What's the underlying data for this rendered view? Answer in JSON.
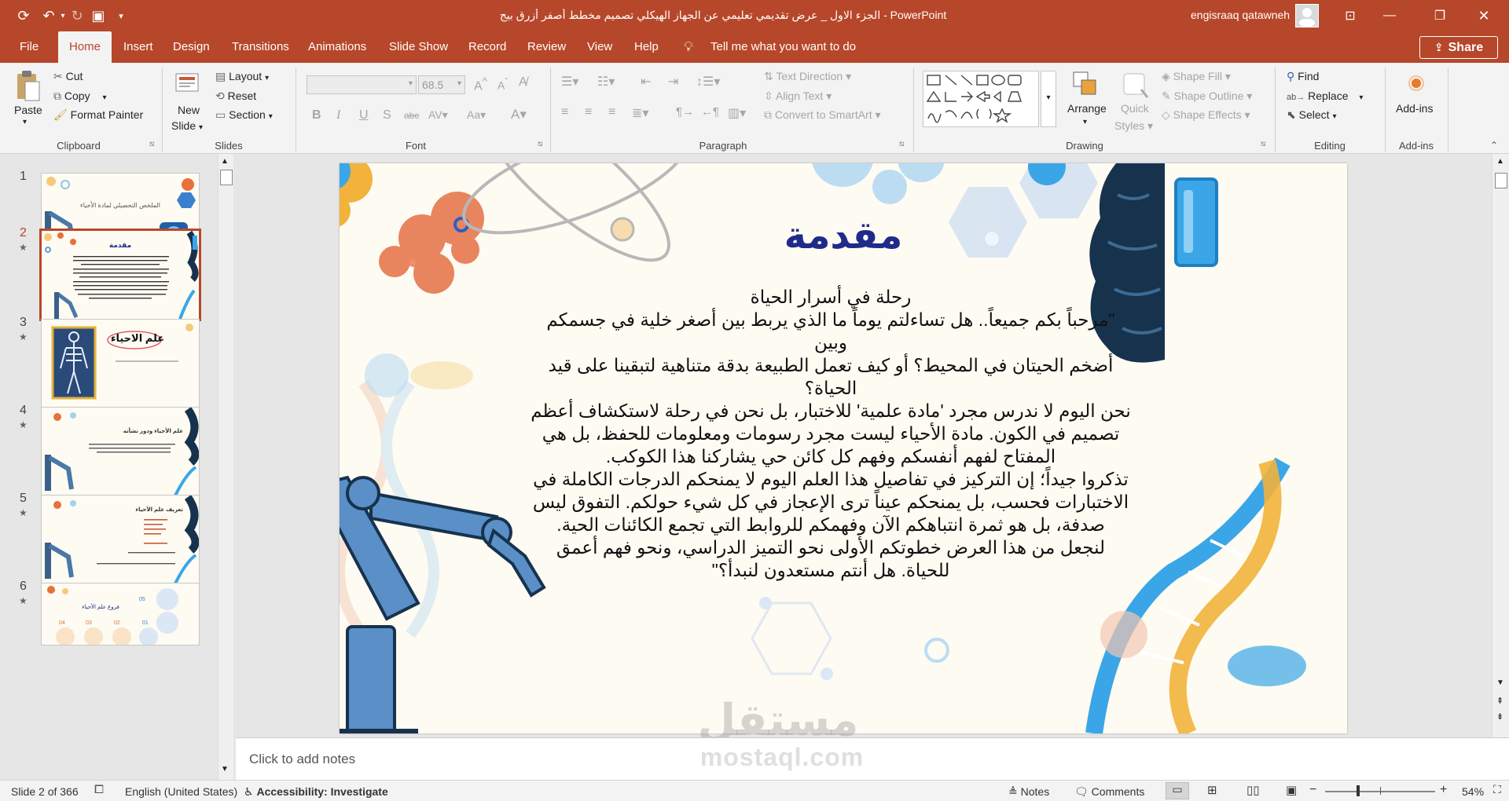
{
  "window": {
    "title": "الجزء الاول _ عرض تقديمي تعليمي عن الجهاز الهيكلي تصميم مخطط أصفر أزرق بيج - PowerPoint",
    "user": "engisraaq qatawneh"
  },
  "tabs": [
    "File",
    "Home",
    "Insert",
    "Design",
    "Transitions",
    "Animations",
    "Slide Show",
    "Record",
    "Review",
    "View",
    "Help"
  ],
  "active_tab": "Home",
  "tell_me": "Tell me what you want to do",
  "share_label": "Share",
  "ribbon": {
    "clipboard": {
      "paste": "Paste",
      "cut": "Cut",
      "copy": "Copy",
      "format_painter": "Format Painter",
      "group": "Clipboard"
    },
    "slides": {
      "new_slide_1": "New",
      "new_slide_2": "Slide",
      "layout": "Layout",
      "reset": "Reset",
      "section": "Section",
      "group": "Slides"
    },
    "font": {
      "size": "68.5",
      "group": "Font"
    },
    "paragraph": {
      "text_direction": "Text Direction",
      "align_text": "Align Text",
      "convert_smartart": "Convert to SmartArt",
      "group": "Paragraph"
    },
    "drawing": {
      "arrange": "Arrange",
      "quick_styles_1": "Quick",
      "quick_styles_2": "Styles",
      "shape_fill": "Shape Fill",
      "shape_outline": "Shape Outline",
      "shape_effects": "Shape Effects",
      "group": "Drawing"
    },
    "editing": {
      "find": "Find",
      "replace": "Replace",
      "select": "Select",
      "group": "Editing"
    },
    "addins": {
      "label": "Add-ins",
      "group": "Add-ins"
    }
  },
  "thumbnails": [
    {
      "num": "1",
      "star": "",
      "title": "الملخص التحصيلي لمادة الأحياء"
    },
    {
      "num": "2",
      "star": "★",
      "title": "مقدمة"
    },
    {
      "num": "3",
      "star": "★",
      "title": "علم الاحياء"
    },
    {
      "num": "4",
      "star": "★",
      "title": "علم الأحياء ودور نشأته"
    },
    {
      "num": "5",
      "star": "★",
      "title": "تعريف علم الأحياء"
    },
    {
      "num": "6",
      "star": "★",
      "title": "فروع علم الأحياء"
    }
  ],
  "slide": {
    "title": "مقدمة",
    "subtitle": "رحلة في أسرار الحياة",
    "lines": [
      "\"مرحباً بكم جميعاً.. هل تساءلتم يوماً ما الذي يربط بين أصغر خلية في جسمكم وبين",
      "أضخم الحيتان في المحيط؟ أو كيف تعمل الطبيعة بدقة متناهية لتبقينا على قيد",
      "الحياة؟",
      "نحن اليوم لا ندرس مجرد 'مادة علمية' للاختبار، بل نحن في رحلة لاستكشاف أعظم",
      "تصميم في الكون. مادة الأحياء ليست مجرد رسومات ومعلومات للحفظ، بل هي",
      "المفتاح لفهم أنفسكم وفهم كل كائن حي يشاركنا هذا الكوكب.",
      "تذكروا جيداً؛ إن التركيز في تفاصيل هذا العلم اليوم لا يمنحكم الدرجات الكاملة في",
      "الاختبارات فحسب، بل يمنحكم عيناً ترى الإعجاز في كل شيء حولكم. التفوق ليس",
      "صدفة، بل هو ثمرة انتباهكم الآن وفهمكم للروابط التي تجمع الكائنات الحية.",
      "لنجعل من هذا العرض خطوتكم الأولى نحو التميز الدراسي، ونحو فهم أعمق",
      "للحياة. هل أنتم مستعدون لنبدأ؟\""
    ]
  },
  "watermark": {
    "arabic": "مستقل",
    "latin": "mostaql.com"
  },
  "notes_placeholder": "Click to add notes",
  "status": {
    "slide": "Slide 2 of 366",
    "language": "English (United States)",
    "accessibility": "Accessibility: Investigate",
    "notes": "Notes",
    "comments": "Comments",
    "zoom": "54%"
  },
  "colors": {
    "accent": "#b7472a",
    "title": "#1f2a8a",
    "slide_bg": "#fdfbf2"
  }
}
